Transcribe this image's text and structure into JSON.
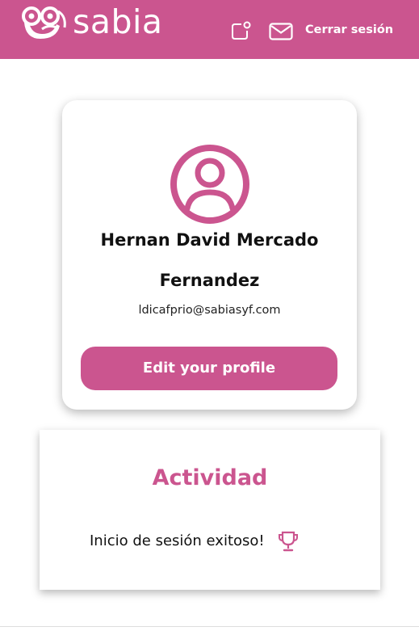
{
  "header": {
    "brand": "sabia",
    "notifications_icon": "notification-icon",
    "mail_icon": "mail-icon",
    "logout_label": "Cerrar sesión"
  },
  "profile": {
    "avatar_icon": "user-circle-icon",
    "name": "Hernan David Mercado Fernandez",
    "email": "ldicafprio@sabiasyf.com",
    "edit_button": "Edit your profile"
  },
  "activity": {
    "title": "Actividad",
    "items": [
      {
        "text": "Inicio de sesión exitoso!",
        "icon": "trophy-icon"
      }
    ]
  },
  "colors": {
    "brand": "#cb558f",
    "background": "#ffffff",
    "text": "#111111"
  }
}
